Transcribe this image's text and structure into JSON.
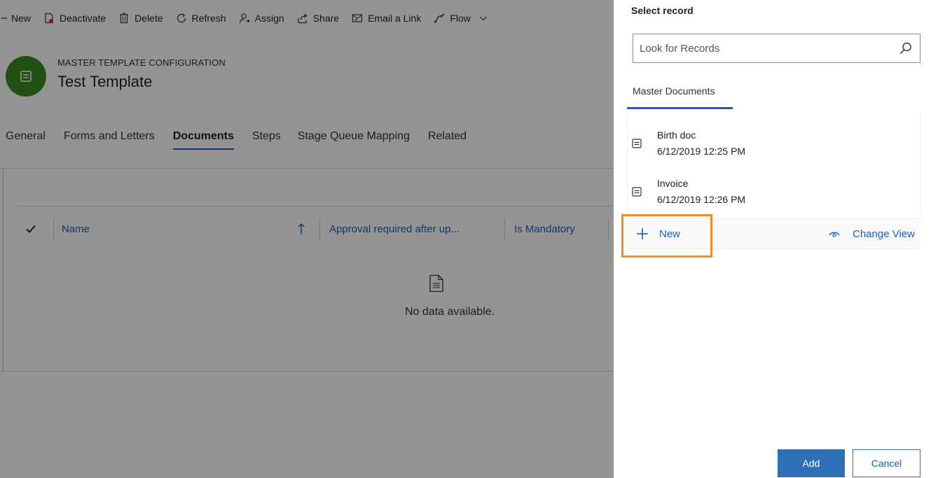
{
  "command_bar": {
    "new_label": "New",
    "deactivate_label": "Deactivate",
    "delete_label": "Delete",
    "refresh_label": "Refresh",
    "assign_label": "Assign",
    "share_label": "Share",
    "email_link_label": "Email a Link",
    "flow_label": "Flow"
  },
  "record": {
    "entity_type": "MASTER TEMPLATE CONFIGURATION",
    "title": "Test Template"
  },
  "tabs": [
    {
      "label": "General"
    },
    {
      "label": "Forms and Letters"
    },
    {
      "label": "Documents",
      "active": true
    },
    {
      "label": "Steps"
    },
    {
      "label": "Stage Queue Mapping"
    },
    {
      "label": "Related"
    }
  ],
  "grid": {
    "columns": [
      "Name",
      "Approval required after up...",
      "Is Mandatory"
    ],
    "empty_message": "No data available."
  },
  "lookup_panel": {
    "title": "Select record",
    "search_placeholder": "Look for Records",
    "tab_label": "Master Documents",
    "records": [
      {
        "name": "Birth doc",
        "date": "6/12/2019 12:25 PM"
      },
      {
        "name": "Invoice",
        "date": "6/12/2019 12:26 PM"
      }
    ],
    "new_label": "New",
    "change_view_label": "Change View",
    "add_label": "Add",
    "cancel_label": "Cancel"
  },
  "colors": {
    "accent": "#1a5fb4",
    "avatar": "#3c8a1f",
    "highlight": "#f28a2b",
    "primary_button": "#2f6fb8"
  },
  "icons": {
    "deactivate": "deactivate-icon",
    "delete": "trash-icon",
    "refresh": "refresh-icon",
    "assign": "person-icon",
    "share": "share-icon",
    "email": "email-icon",
    "flow": "flow-icon",
    "search": "search-icon",
    "record": "record-entity-icon",
    "new": "plus-icon",
    "change_view": "eye-icon"
  }
}
